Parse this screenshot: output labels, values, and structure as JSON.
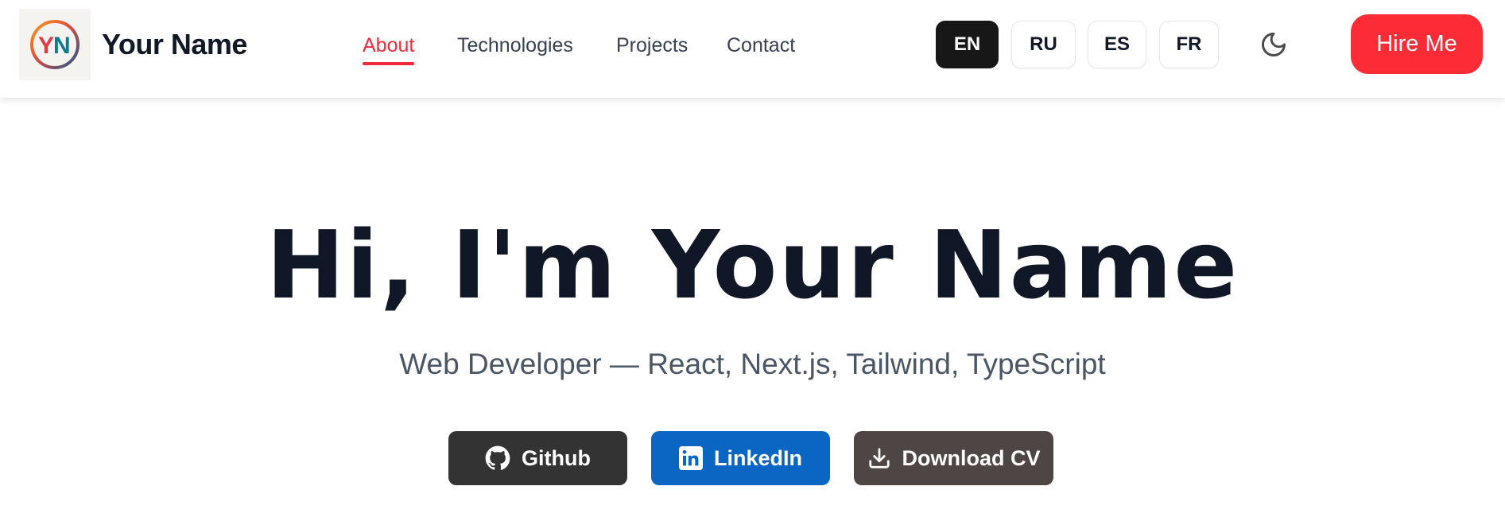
{
  "brand": {
    "initials": "YN",
    "name": "Your Name"
  },
  "nav": {
    "items": [
      {
        "label": "About",
        "active": true
      },
      {
        "label": "Technologies",
        "active": false
      },
      {
        "label": "Projects",
        "active": false
      },
      {
        "label": "Contact",
        "active": false
      }
    ]
  },
  "languages": [
    {
      "label": "EN",
      "active": true
    },
    {
      "label": "RU",
      "active": false
    },
    {
      "label": "ES",
      "active": false
    },
    {
      "label": "FR",
      "active": false
    }
  ],
  "theme_toggle": {
    "icon": "moon-icon"
  },
  "hire_button": {
    "label": "Hire Me"
  },
  "hero": {
    "title": "Hi, I'm Your Name",
    "subtitle": "Web Developer — React, Next.js, Tailwind, TypeScript"
  },
  "buttons": [
    {
      "label": "Github",
      "icon": "github-icon",
      "color": "#333333"
    },
    {
      "label": "LinkedIn",
      "icon": "linkedin-icon",
      "color": "#0a66c2"
    },
    {
      "label": "Download CV",
      "icon": "download-icon",
      "color": "#4e4645"
    }
  ],
  "colors": {
    "accent": "#ef2b3b",
    "hire": "#fb2c36",
    "title": "#101828",
    "subtitle": "#4a5565"
  }
}
